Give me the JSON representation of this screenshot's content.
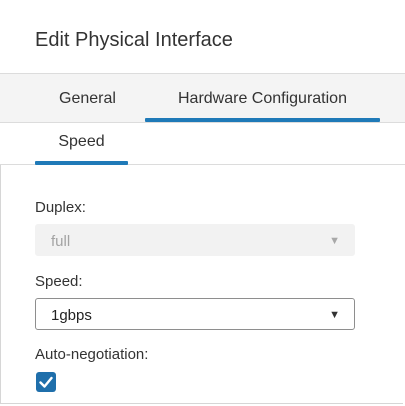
{
  "dialog": {
    "title": "Edit Physical Interface"
  },
  "tabs": [
    {
      "label": "General",
      "active": false
    },
    {
      "label": "Hardware Configuration",
      "active": true
    }
  ],
  "subtabs": [
    {
      "label": "Speed",
      "active": true
    }
  ],
  "form": {
    "duplex": {
      "label": "Duplex:",
      "value": "full",
      "disabled": true
    },
    "speed": {
      "label": "Speed:",
      "value": "1gbps",
      "disabled": false
    },
    "auto_negotiation": {
      "label": "Auto-negotiation:",
      "checked": true
    }
  },
  "icons": {
    "dropdown": "chevron-down-icon",
    "check": "checkmark-icon"
  },
  "colors": {
    "accent": "#1f7ab8",
    "checkbox": "#1f6fab",
    "tabbar_bg": "#f4f4f4",
    "disabled_bg": "#f2f2f2"
  }
}
